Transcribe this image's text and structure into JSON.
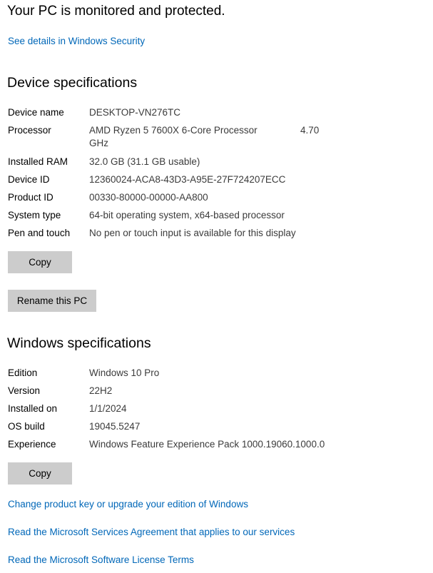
{
  "header": {
    "title": "Your PC is monitored and protected."
  },
  "links": {
    "security_details": "See details in Windows Security",
    "change_product_key": "Change product key or upgrade your edition of Windows",
    "services_agreement": "Read the Microsoft Services Agreement that applies to our services",
    "license_terms": "Read the Microsoft Software License Terms"
  },
  "device": {
    "heading": "Device specifications",
    "rows": [
      {
        "label": "Device name",
        "value": "DESKTOP-VN276TC"
      },
      {
        "label": "Processor",
        "value": "AMD Ryzen 5 7600X 6-Core Processor",
        "value_extra": "4.70",
        "value_wrap": "GHz"
      },
      {
        "label": "Installed RAM",
        "value": "32.0 GB (31.1 GB usable)"
      },
      {
        "label": "Device ID",
        "value": "12360024-ACA8-43D3-A95E-27F724207ECC"
      },
      {
        "label": "Product ID",
        "value": "00330-80000-00000-AA800"
      },
      {
        "label": "System type",
        "value": "64-bit operating system, x64-based processor"
      },
      {
        "label": "Pen and touch",
        "value": "No pen or touch input is available for this display"
      }
    ],
    "copy_label": "Copy",
    "rename_label": "Rename this PC"
  },
  "windows": {
    "heading": "Windows specifications",
    "rows": [
      {
        "label": "Edition",
        "value": "Windows 10 Pro"
      },
      {
        "label": "Version",
        "value": "22H2"
      },
      {
        "label": "Installed on",
        "value": "1/1/2024"
      },
      {
        "label": "OS build",
        "value": "19045.5247"
      },
      {
        "label": "Experience",
        "value": "Windows Feature Experience Pack 1000.19060.1000.0"
      }
    ],
    "copy_label": "Copy"
  },
  "colors": {
    "link": "#0067b8",
    "button_bg": "#cccccc",
    "value_text": "#3b3b3b"
  }
}
